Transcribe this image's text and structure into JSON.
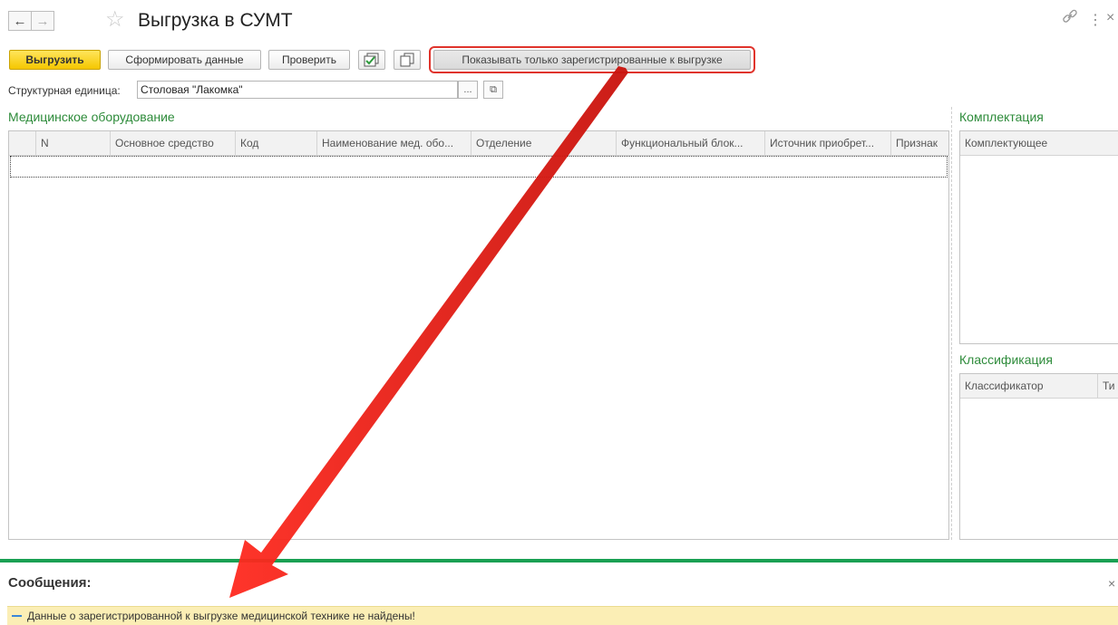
{
  "window": {
    "title": "Выгрузка в СУМТ",
    "back_icon": "←",
    "forward_icon": "→",
    "star_icon": "☆",
    "link_icon": "🔗",
    "more_icon": "⋮",
    "close_icon": "×"
  },
  "toolbar": {
    "export_label": "Выгрузить",
    "form_data_label": "Сформировать данные",
    "check_label": "Проверить",
    "show_registered_label": "Показывать только зарегистрированные к выгрузке",
    "highlight_color": "#e0342c"
  },
  "unit_field": {
    "label": "Структурная единица:",
    "value": "Столовая \"Лакомка\"",
    "select_label": "...",
    "open_label": "⧉"
  },
  "equipment": {
    "section_title": "Медицинское оборудование",
    "columns": [
      "N",
      "Основное средство",
      "Код",
      "Наименование мед. обо...",
      "Отделение",
      "Функциональный блок...",
      "Источник приобрет...",
      "Признак"
    ]
  },
  "kit": {
    "section_title": "Комплектация",
    "columns": [
      "Комплектующее"
    ]
  },
  "classification": {
    "section_title": "Классификация",
    "columns": [
      "Классификатор",
      "Ти"
    ]
  },
  "messages": {
    "title": "Сообщения:",
    "close_icon": "×",
    "items": [
      {
        "text": "Данные о зарегистрированной к выгрузке медицинской технике не найдены!"
      }
    ],
    "accent_color": "#1aa053"
  }
}
